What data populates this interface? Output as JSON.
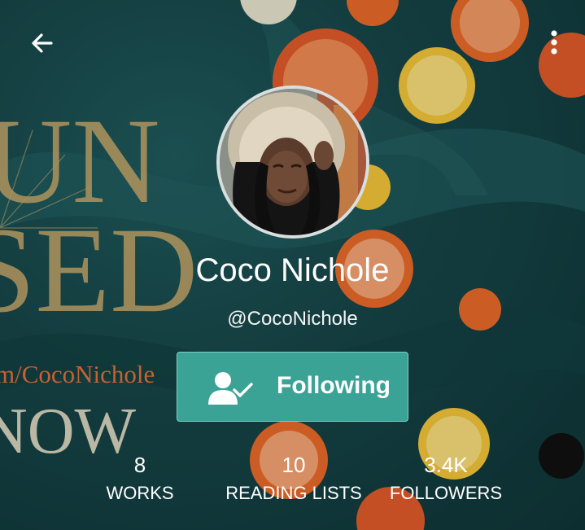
{
  "background": {
    "cover_text_lines": [
      "UN",
      "SED",
      "m/CocoNichole",
      "NOW"
    ],
    "colors": {
      "teal_dark": "#0f3537",
      "teal": "#1f5a5c",
      "gold": "#c9a86a",
      "citrus_orange": "#e8692a",
      "citrus_yellow": "#f2c43a"
    }
  },
  "toolbar": {
    "back_icon": "arrow-left-icon",
    "more_icon": "more-vertical-icon"
  },
  "profile": {
    "display_name": "Coco Nichole",
    "username": "@CocoNichole",
    "follow_button": {
      "label": "Following",
      "icon": "user-check-icon",
      "color": "#3aa396"
    }
  },
  "stats": [
    {
      "value": "8",
      "label": "WORKS"
    },
    {
      "value": "10",
      "label": "READING LISTS"
    },
    {
      "value": "3.4K",
      "label": "FOLLOWERS"
    }
  ]
}
